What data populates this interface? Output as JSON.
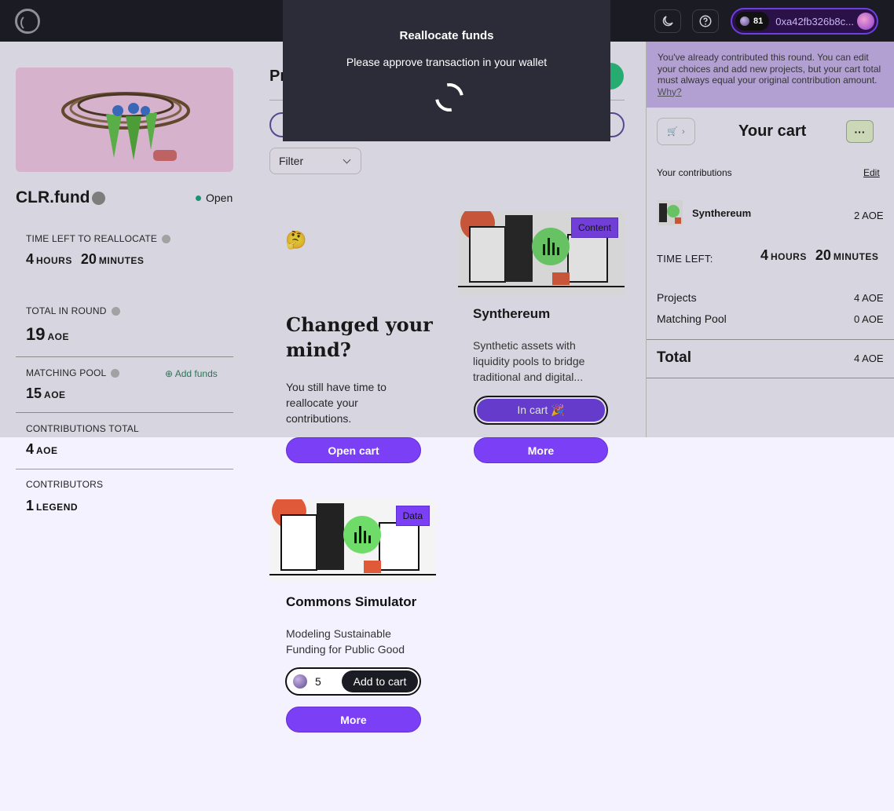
{
  "wallet": {
    "balance": "81",
    "address": "0xa42fb326b8c..."
  },
  "project": {
    "name": "CLR.fund",
    "status": "Open"
  },
  "stats": {
    "time_left_label": "TIME LEFT TO REALLOCATE",
    "time_hours": "4",
    "time_hours_unit": "HOURS",
    "time_minutes": "20",
    "time_minutes_unit": "MINUTES",
    "total_label": "TOTAL IN ROUND",
    "total_value": "19",
    "matching_label": "MATCHING POOL",
    "matching_value": "15",
    "add_funds": "Add funds",
    "contrib_total_label": "CONTRIBUTIONS TOTAL",
    "contrib_total_value": "4",
    "contributors_label": "CONTRIBUTORS",
    "contributors_value": "1",
    "contributors_unit": "LEGEND",
    "unit": "AOE"
  },
  "main": {
    "heading_fragment": "Pr",
    "filter_label": "Filter",
    "changed": {
      "emoji": "🤔",
      "title": "Changed your mind?",
      "desc": "You still have time to reallocate your contributions.",
      "button": "Open cart"
    },
    "cards": [
      {
        "name": "Synthereum",
        "badge": "Content",
        "desc": "Synthetic assets with liquidity pools to bridge traditional and digital...",
        "in_cart": "In cart 🎉",
        "more": "More"
      },
      {
        "name": "Commons Simulator",
        "badge": "Data",
        "desc": "Modeling Sustainable Funding for Public Good",
        "qty": "5",
        "add": "Add to cart",
        "more": "More"
      }
    ]
  },
  "cart": {
    "notice": "You've already contributed this round. You can edit your choices and add new projects, but your cart total must always equal your original contribution amount.",
    "notice_link": "Why?",
    "title": "Your cart",
    "more_btn": "···",
    "contrib_label": "Your contributions",
    "edit": "Edit",
    "item_name": "Synthereum",
    "item_amount": "2 AOE",
    "time_left_label": "TIME LEFT:",
    "time_hours": "4",
    "time_hours_unit": "HOURS",
    "time_minutes": "20",
    "time_minutes_unit": "MINUTES",
    "projects_label": "Projects",
    "projects_amount": "4 AOE",
    "matching_label": "Matching Pool",
    "matching_amount": "0 AOE",
    "total_label": "Total",
    "total_amount": "4 AOE"
  },
  "modal": {
    "title": "Reallocate funds",
    "message": "Please approve transaction in your wallet"
  },
  "colors": {
    "accent": "#7b3ff5",
    "topbar": "#1b1b23",
    "modal": "#2c2b38",
    "notice": "#c9b3f0",
    "status": "#19a37a"
  }
}
